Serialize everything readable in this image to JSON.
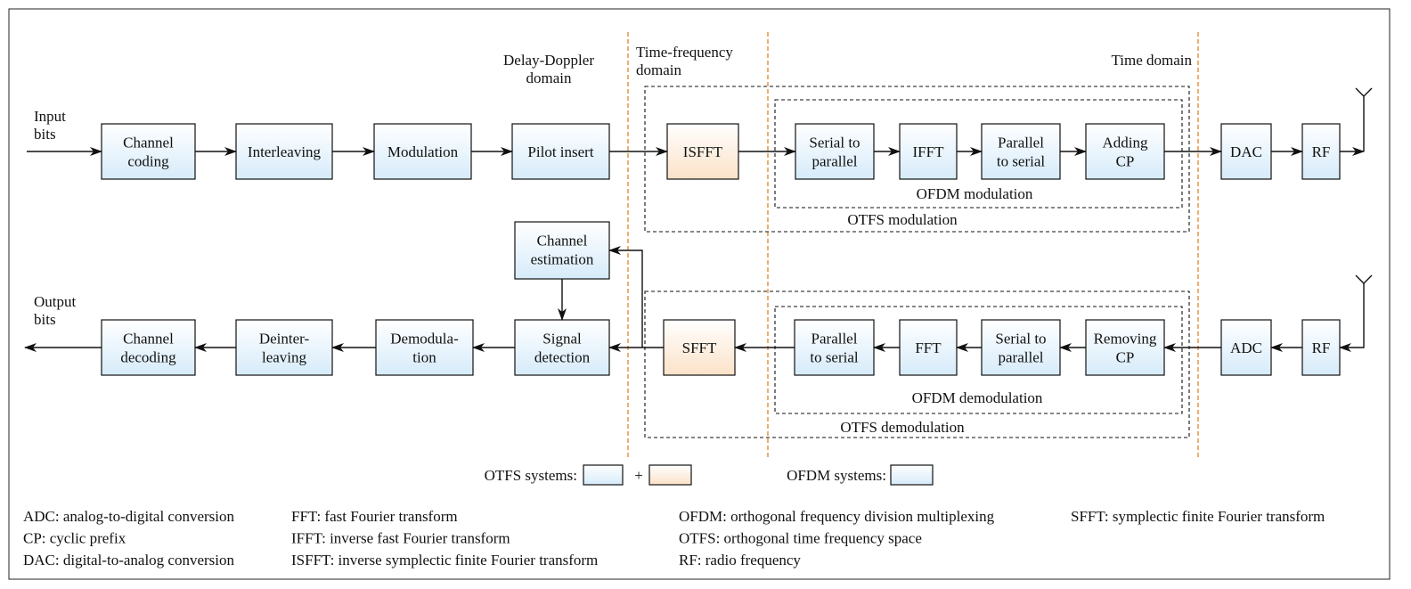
{
  "colors": {
    "ofdm_block": "#dbeefb",
    "otfs_block": "#fde8d2",
    "domain_divider": "#e07a10"
  },
  "io": {
    "input": [
      "Input",
      "bits"
    ],
    "output": [
      "Output",
      "bits"
    ]
  },
  "domains": {
    "delay_doppler": [
      "Delay-Doppler",
      "domain"
    ],
    "time_frequency": [
      "Time-frequency",
      "domain"
    ],
    "time": [
      "Time domain"
    ]
  },
  "blocks": {
    "channel_coding": [
      "Channel",
      "coding"
    ],
    "interleaving": [
      "Interleaving"
    ],
    "modulation": [
      "Modulation"
    ],
    "pilot_insert": [
      "Pilot insert"
    ],
    "isfft": [
      "ISFFT"
    ],
    "serial_to_parallel_tx": [
      "Serial to",
      "parallel"
    ],
    "ifft": [
      "IFFT"
    ],
    "parallel_to_serial_tx": [
      "Parallel",
      "to serial"
    ],
    "adding_cp": [
      "Adding",
      "CP"
    ],
    "dac": [
      "DAC"
    ],
    "rf_tx": [
      "RF"
    ],
    "channel_estimation": [
      "Channel",
      "estimation"
    ],
    "channel_decoding": [
      "Channel",
      "decoding"
    ],
    "deinterleaving": [
      "Deinter-",
      "leaving"
    ],
    "demodulation": [
      "Demodula-",
      "tion"
    ],
    "signal_detection": [
      "Signal",
      "detection"
    ],
    "sfft": [
      "SFFT"
    ],
    "parallel_to_serial_rx": [
      "Parallel",
      "to serial"
    ],
    "fft": [
      "FFT"
    ],
    "serial_to_parallel_rx": [
      "Serial to",
      "parallel"
    ],
    "removing_cp": [
      "Removing",
      "CP"
    ],
    "adc": [
      "ADC"
    ],
    "rf_rx": [
      "RF"
    ]
  },
  "groups": {
    "ofdm_modulation": "OFDM modulation",
    "otfs_modulation": "OTFS modulation",
    "ofdm_demodulation": "OFDM demodulation",
    "otfs_demodulation": "OTFS demodulation"
  },
  "legend": {
    "otfs": "OTFS systems:",
    "plus": "+",
    "ofdm": "OFDM systems:"
  },
  "abbreviations": [
    [
      "ADC: analog-to-digital conversion",
      "CP: cyclic prefix",
      "DAC: digital-to-analog conversion"
    ],
    [
      "FFT: fast Fourier transform",
      "IFFT: inverse fast Fourier transform",
      "ISFFT: inverse symplectic finite Fourier transform"
    ],
    [
      "OFDM: orthogonal frequency division multiplexing",
      "OTFS: orthogonal time frequency space",
      "RF: radio frequency"
    ],
    [
      "SFFT: symplectic finite Fourier transform"
    ]
  ]
}
